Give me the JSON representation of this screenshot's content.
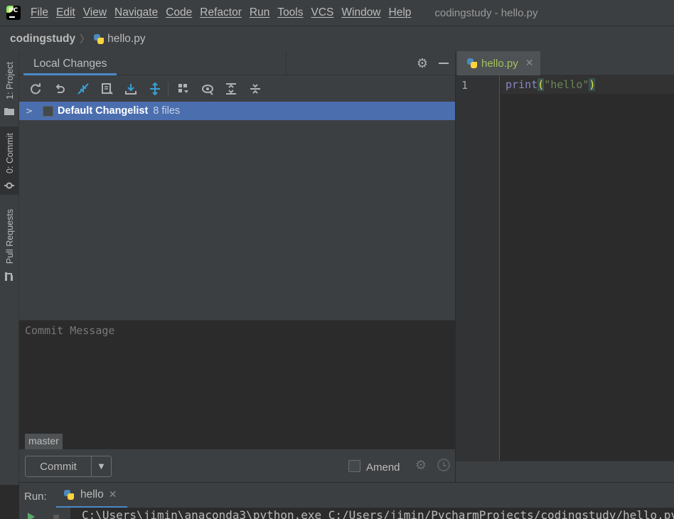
{
  "menubar": {
    "items": [
      "File",
      "Edit",
      "View",
      "Navigate",
      "Code",
      "Refactor",
      "Run",
      "Tools",
      "VCS",
      "Window",
      "Help"
    ],
    "window_title": "codingstudy - hello.py",
    "logo_text": "PC"
  },
  "breadcrumb": {
    "project": "codingstudy",
    "file": "hello.py"
  },
  "left_strip": {
    "project_tab": "1: Project",
    "commit_tab": "0: Commit",
    "pull_requests_tab": "Pull Requests"
  },
  "commit_panel": {
    "tab_label": "Local Changes",
    "toolbar_icons": [
      "refresh-icon",
      "rollback-icon",
      "diff-icon",
      "edit-changelist-icon",
      "shelve-icon",
      "group-by-icon",
      "view-options-icon",
      "show-diff-icon",
      "expand-all-icon",
      "collapse-all-icon"
    ],
    "changelist": {
      "name": "Default Changelist",
      "count": "8 files"
    },
    "commit_message_placeholder": "Commit Message",
    "branch": "master",
    "commit_button": "Commit",
    "amend_label": "Amend"
  },
  "editor": {
    "tab_label": "hello.py",
    "line_number": "1",
    "code": {
      "fn": "print",
      "open_paren": "(",
      "string": "\"hello\"",
      "close_paren": ")"
    }
  },
  "run_panel": {
    "label": "Run:",
    "tab_label": "hello",
    "console_output": "C:\\Users\\jimin\\anaconda3\\python.exe C:/Users/jimin/PycharmProjects/codingstudy/hello.py"
  },
  "colors": {
    "selection": "#4b6eaf",
    "accent": "#4a88c7",
    "panel_bg": "#3c3f41",
    "editor_bg": "#2b2b2b"
  }
}
